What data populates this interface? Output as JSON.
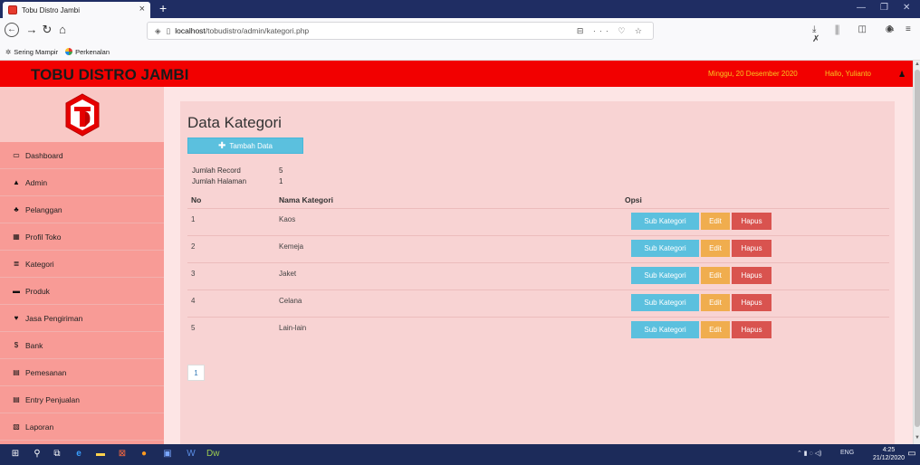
{
  "browser": {
    "tab_title": "Tobu Distro Jambi",
    "tab_close": "×",
    "new_tab": "+",
    "url_host": "localhost",
    "url_path": "/tobudistro/admin/kategori.php",
    "url_right_icons": "⊟ ··· ♡ ☆",
    "toolbar_icons": "⤓ ⫼ ◫ ◉ ✗",
    "bookmarks": [
      "Sering Mampir",
      "Perkenalan"
    ],
    "window_controls": [
      "—",
      "❐",
      "✕"
    ]
  },
  "header": {
    "brand": "TOBU DISTRO JAMBI",
    "date": "Minggu, 20 Desember 2020",
    "user": "Hallo, Yulianto"
  },
  "sidebar": {
    "items": [
      {
        "label": "Dashboard",
        "icon": "monitor-icon",
        "glyph": "▭"
      },
      {
        "label": "Admin",
        "icon": "user-icon",
        "glyph": "▲"
      },
      {
        "label": "Pelanggan",
        "icon": "users-icon",
        "glyph": "♣"
      },
      {
        "label": "Profil Toko",
        "icon": "table-icon",
        "glyph": "▦"
      },
      {
        "label": "Kategori",
        "icon": "list-icon",
        "glyph": "≣"
      },
      {
        "label": "Produk",
        "icon": "cart-icon",
        "glyph": "▬"
      },
      {
        "label": "Jasa Pengiriman",
        "icon": "map-marker-icon",
        "glyph": "♥"
      },
      {
        "label": "Bank",
        "icon": "dollar-icon",
        "glyph": "$"
      },
      {
        "label": "Pemesanan",
        "icon": "credit-card-icon",
        "glyph": "▤"
      },
      {
        "label": "Entry Penjualan",
        "icon": "credit-card-icon",
        "glyph": "▤"
      },
      {
        "label": "Laporan",
        "icon": "file-icon",
        "glyph": "▧"
      }
    ]
  },
  "main": {
    "title": "Data Kategori",
    "add_button": "Tambah Data",
    "record_label": "Jumlah Record",
    "record_value": "5",
    "pages_label": "Jumlah Halaman",
    "pages_value": "1",
    "columns": [
      "No",
      "Nama Kategori",
      "Opsi"
    ],
    "rows": [
      {
        "no": "1",
        "name": "Kaos"
      },
      {
        "no": "2",
        "name": "Kemeja"
      },
      {
        "no": "3",
        "name": "Jaket"
      },
      {
        "no": "4",
        "name": "Celana"
      },
      {
        "no": "5",
        "name": "Lain-lain"
      }
    ],
    "btn_sub": "Sub Kategori",
    "btn_edit": "Edit",
    "btn_delete": "Hapus",
    "page_number": "1"
  },
  "taskbar": {
    "tray_text": "ENG",
    "time": "4:25",
    "date": "21/12/2020"
  },
  "colors": {
    "header_red": "#f20000",
    "sidebar_pink": "#f89b96",
    "info_blue": "#5bc0de",
    "warning_orange": "#f0ad4e",
    "danger_red": "#d9534f"
  }
}
